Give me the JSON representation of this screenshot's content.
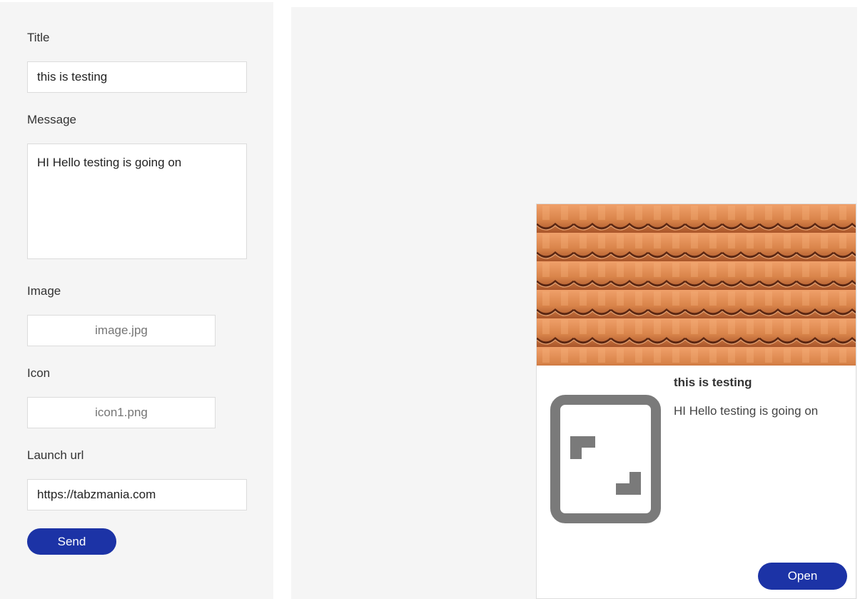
{
  "form": {
    "title_label": "Title",
    "title_value": "this is testing",
    "message_label": "Message",
    "message_value": "HI Hello testing is going on",
    "image_label": "Image",
    "image_file": "image.jpg",
    "icon_label": "Icon",
    "icon_file": "icon1.png",
    "launch_url_label": "Launch url",
    "launch_url_value": "https://tabzmania.com",
    "send_label": "Send"
  },
  "preview": {
    "title": "this is testing",
    "message": "HI Hello testing is going on",
    "open_label": "Open",
    "image_icon": "roof-tiles-image",
    "icon_icon": "fullscreen-icon"
  },
  "colors": {
    "accent": "#1c33a6",
    "panel_bg": "#f5f5f5",
    "icon_gray": "#7a7a7a",
    "tile_orange": "#d9844a"
  }
}
